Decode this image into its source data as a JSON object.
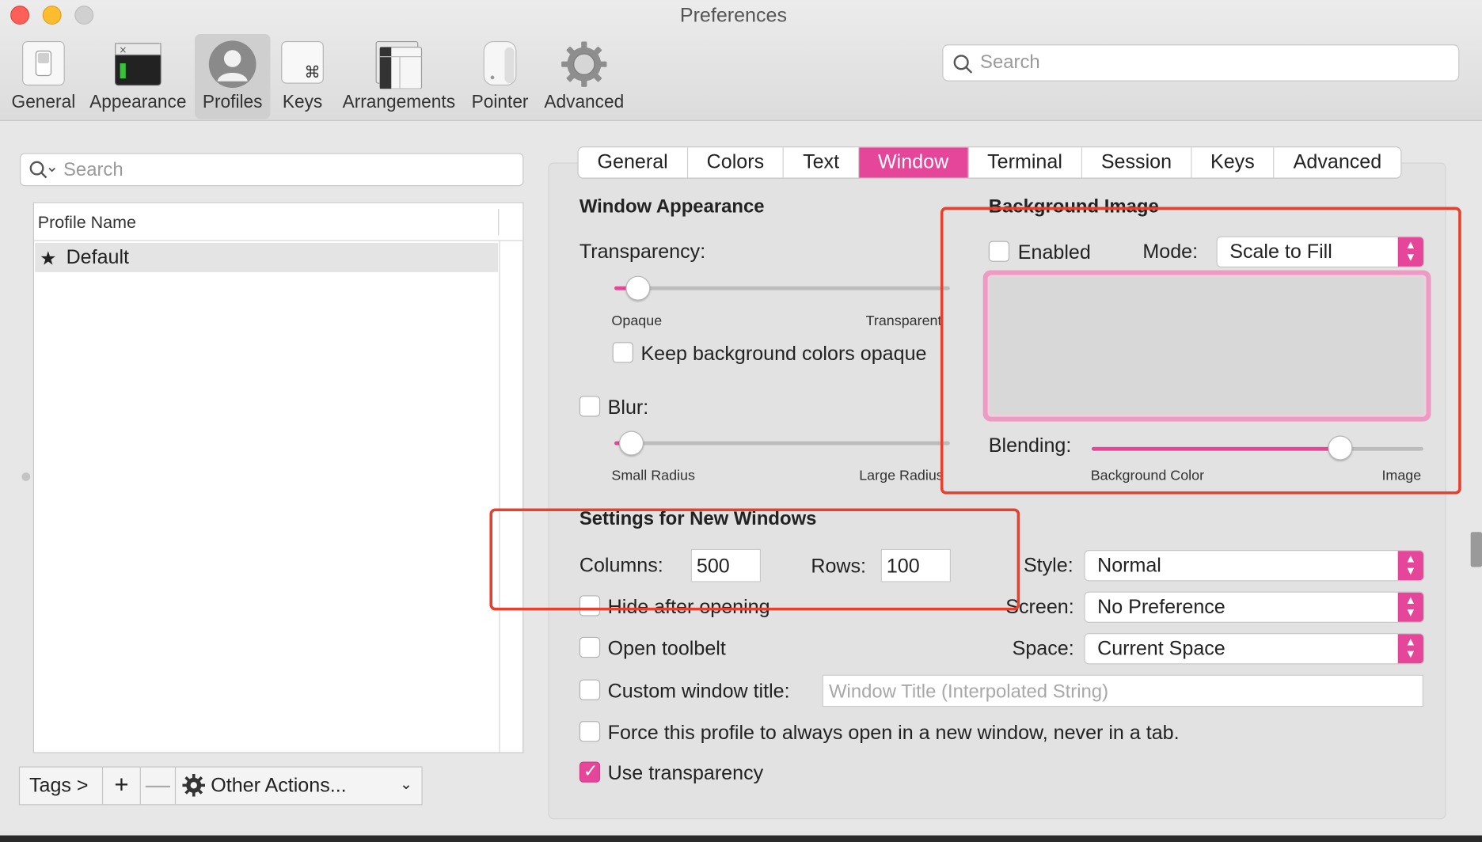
{
  "window": {
    "title": "Preferences"
  },
  "toolbar": {
    "items": [
      {
        "label": "General",
        "icon": "general-switch-icon"
      },
      {
        "label": "Appearance",
        "icon": "appearance-terminal-icon"
      },
      {
        "label": "Profiles",
        "icon": "profiles-person-icon",
        "active": true
      },
      {
        "label": "Keys",
        "icon": "keys-command-icon"
      },
      {
        "label": "Arrangements",
        "icon": "arrangements-windows-icon"
      },
      {
        "label": "Pointer",
        "icon": "pointer-mouse-icon"
      },
      {
        "label": "Advanced",
        "icon": "advanced-gear-icon"
      }
    ],
    "search_placeholder": "Search"
  },
  "profiles": {
    "search_placeholder": "Search",
    "column_header": "Profile Name",
    "rows": [
      {
        "name": "Default",
        "default": true
      }
    ],
    "bottom_bar": {
      "tags": "Tags >",
      "add": "+",
      "remove": "—",
      "other_actions": "Other Actions..."
    }
  },
  "tabs": {
    "items": [
      "General",
      "Colors",
      "Text",
      "Window",
      "Terminal",
      "Session",
      "Keys",
      "Advanced"
    ],
    "active": "Window"
  },
  "window_appearance": {
    "heading": "Window Appearance",
    "transparency_label": "Transparency:",
    "transparency_value": 0.07,
    "transparency_min": "Opaque",
    "transparency_max": "Transparent",
    "keep_bg_opaque": {
      "label": "Keep background colors opaque",
      "checked": false
    },
    "blur": {
      "label": "Blur:",
      "checked": false,
      "value": 0.05
    },
    "blur_min": "Small Radius",
    "blur_max": "Large Radius"
  },
  "background_image": {
    "heading": "Background Image",
    "enabled": {
      "label": "Enabled",
      "checked": false
    },
    "mode_label": "Mode:",
    "mode_value": "Scale to Fill",
    "blending_label": "Blending:",
    "blending_value": 0.75,
    "blending_min": "Background Color",
    "blending_max": "Image"
  },
  "new_windows": {
    "heading": "Settings for New Windows",
    "columns_label": "Columns:",
    "columns_value": "500",
    "rows_label": "Rows:",
    "rows_value": "100",
    "style_label": "Style:",
    "style_value": "Normal",
    "screen_label": "Screen:",
    "screen_value": "No Preference",
    "space_label": "Space:",
    "space_value": "Current Space",
    "hide_after_opening": {
      "label": "Hide after opening",
      "checked": false
    },
    "open_toolbelt": {
      "label": "Open toolbelt",
      "checked": false
    },
    "custom_title": {
      "label": "Custom window title:",
      "checked": false,
      "placeholder": "Window Title (Interpolated String)"
    },
    "force_new_window": {
      "label": "Force this profile to always open in a new window, never in a tab.",
      "checked": false
    },
    "use_transparency": {
      "label": "Use transparency",
      "checked": true
    }
  },
  "colors": {
    "accent": "#e6469a",
    "annotation_red": "#e8402c"
  }
}
